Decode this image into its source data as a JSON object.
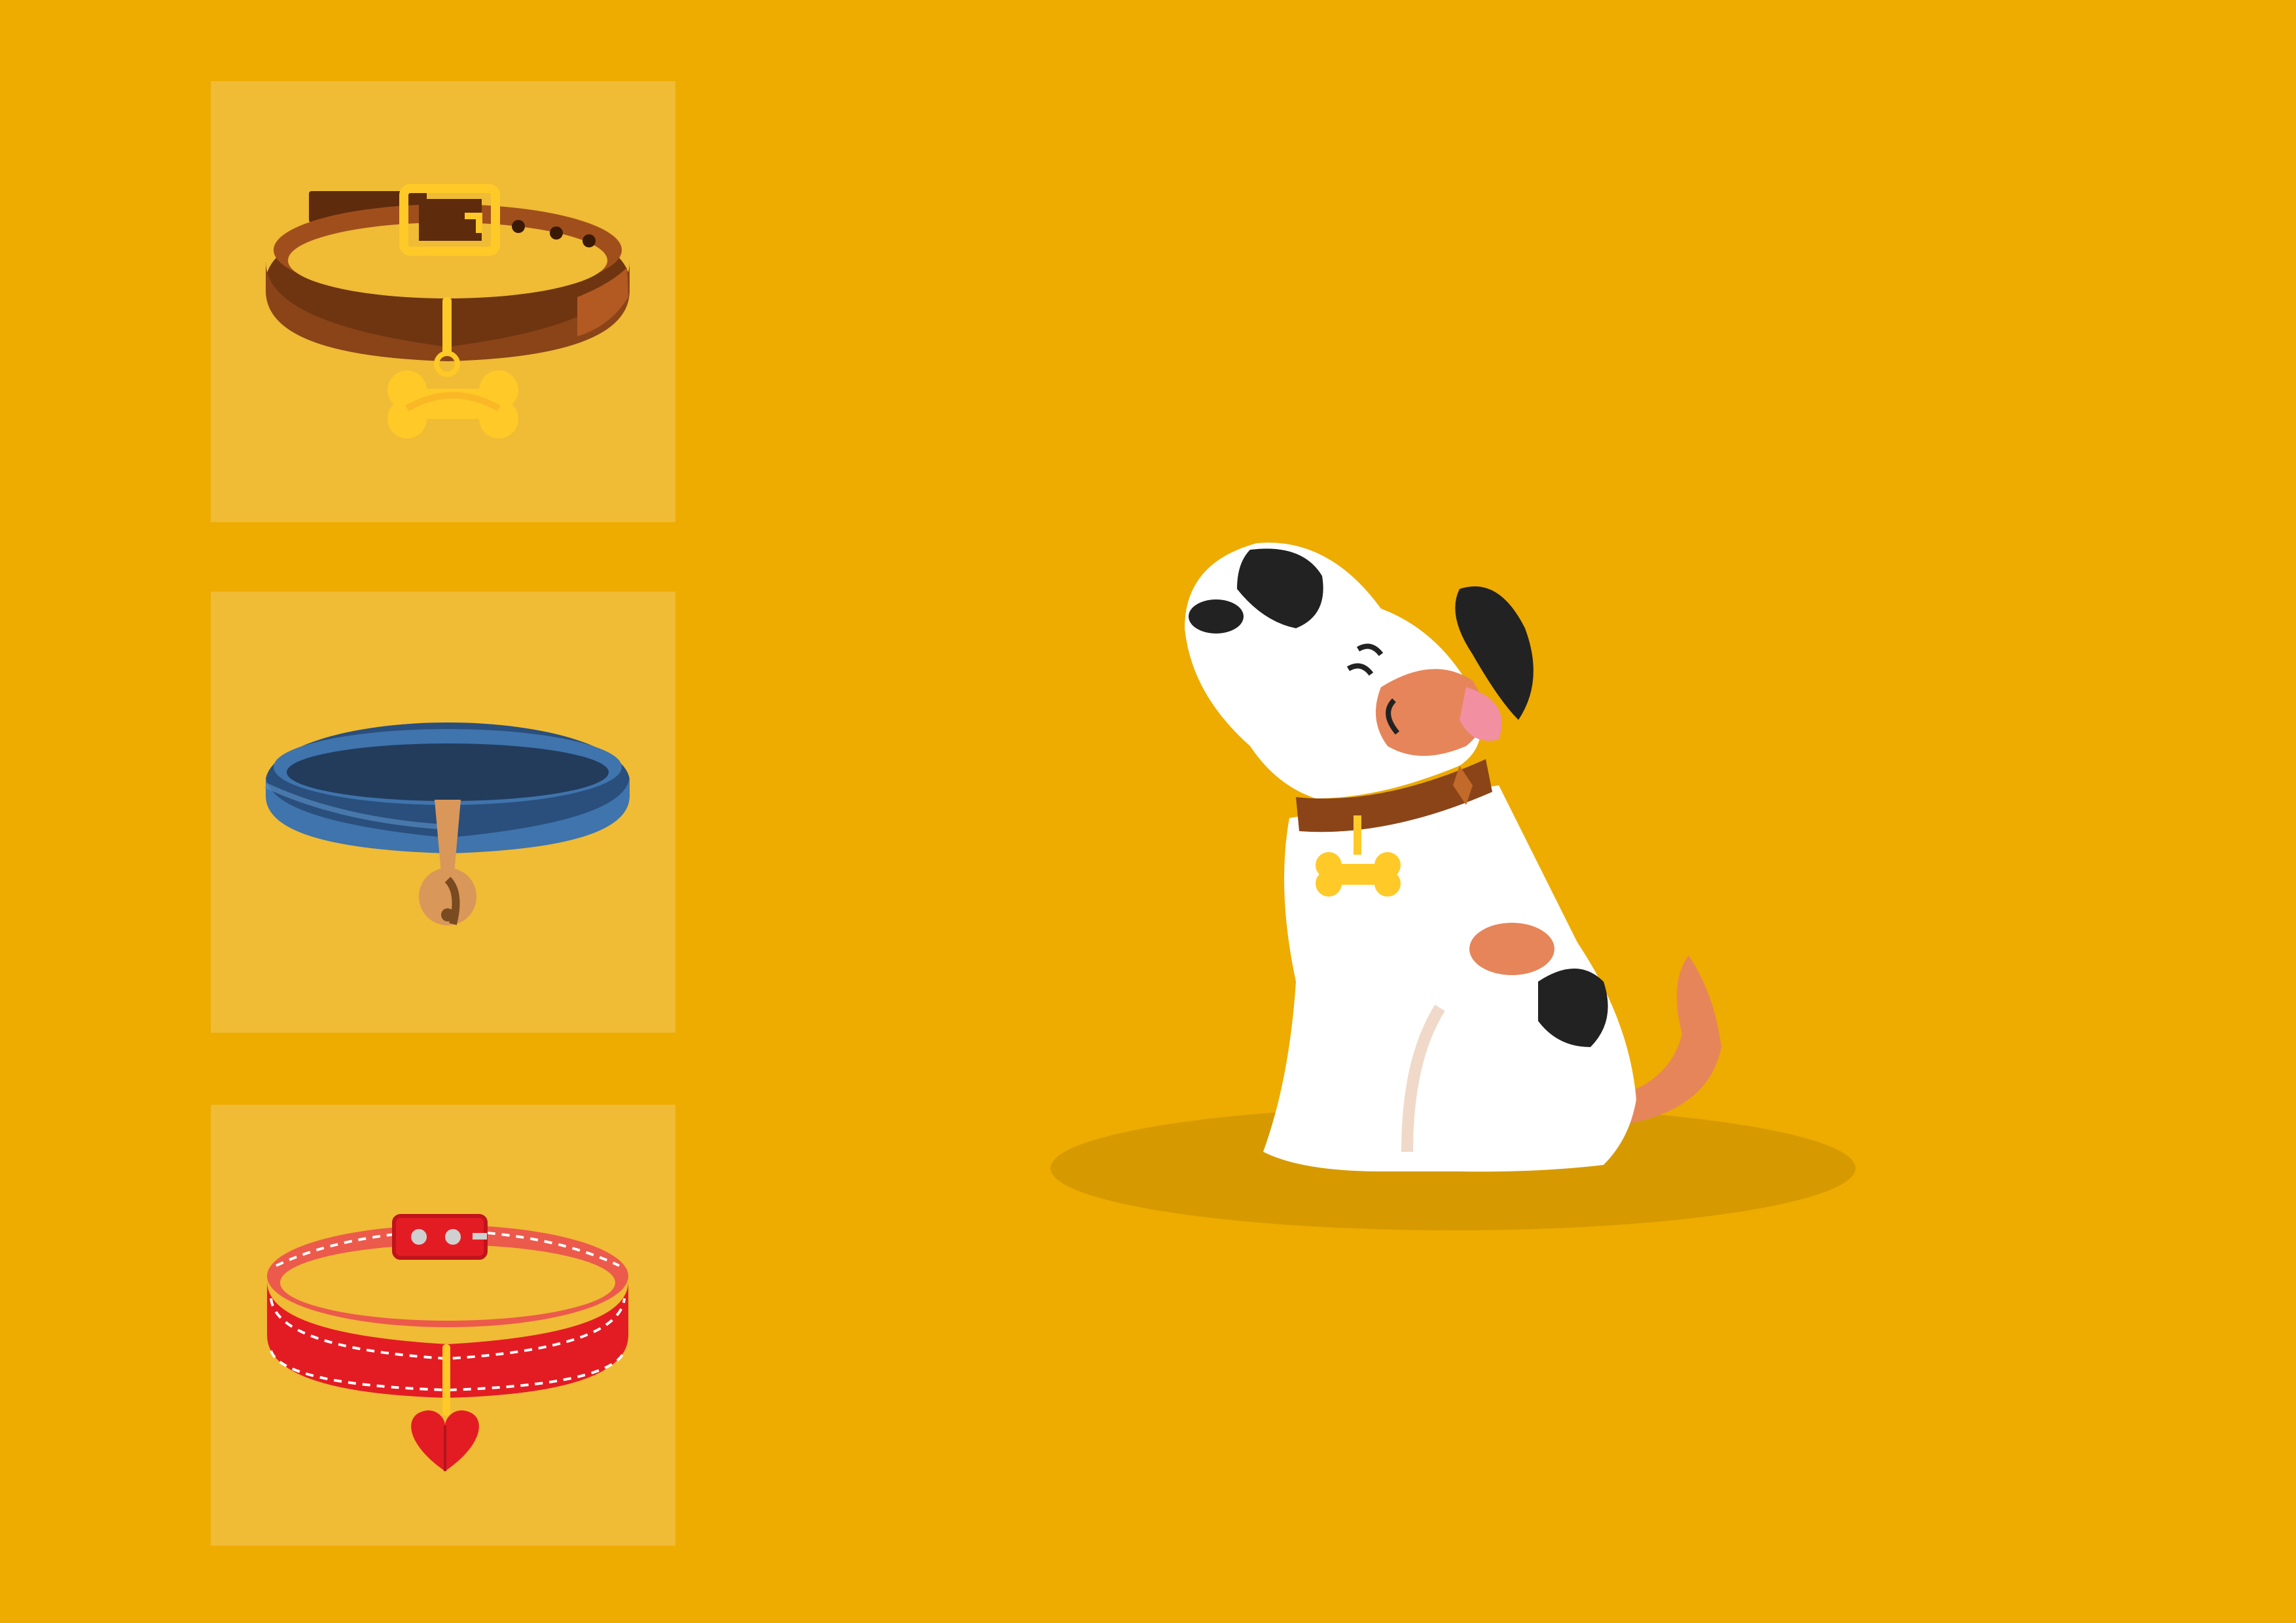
{
  "colors": {
    "background": "#eeab00",
    "card": "#f0bb35",
    "shadow": "#d69a00",
    "brown_collar": "#8a4418",
    "blue_collar": "#3f74ad",
    "red_collar": "#e31c24",
    "tag_gold": "#ffc928",
    "dog_white": "#ffffff",
    "dog_orange": "#e6855a",
    "dog_black": "#222222"
  },
  "collars": [
    {
      "id": "brown",
      "icon": "brown-collar-with-bone-tag-icon"
    },
    {
      "id": "blue",
      "icon": "blue-collar-with-bell-icon"
    },
    {
      "id": "red",
      "icon": "red-collar-with-heart-tag-icon"
    }
  ],
  "dog": {
    "icon": "dog-with-brown-collar-illustration"
  }
}
